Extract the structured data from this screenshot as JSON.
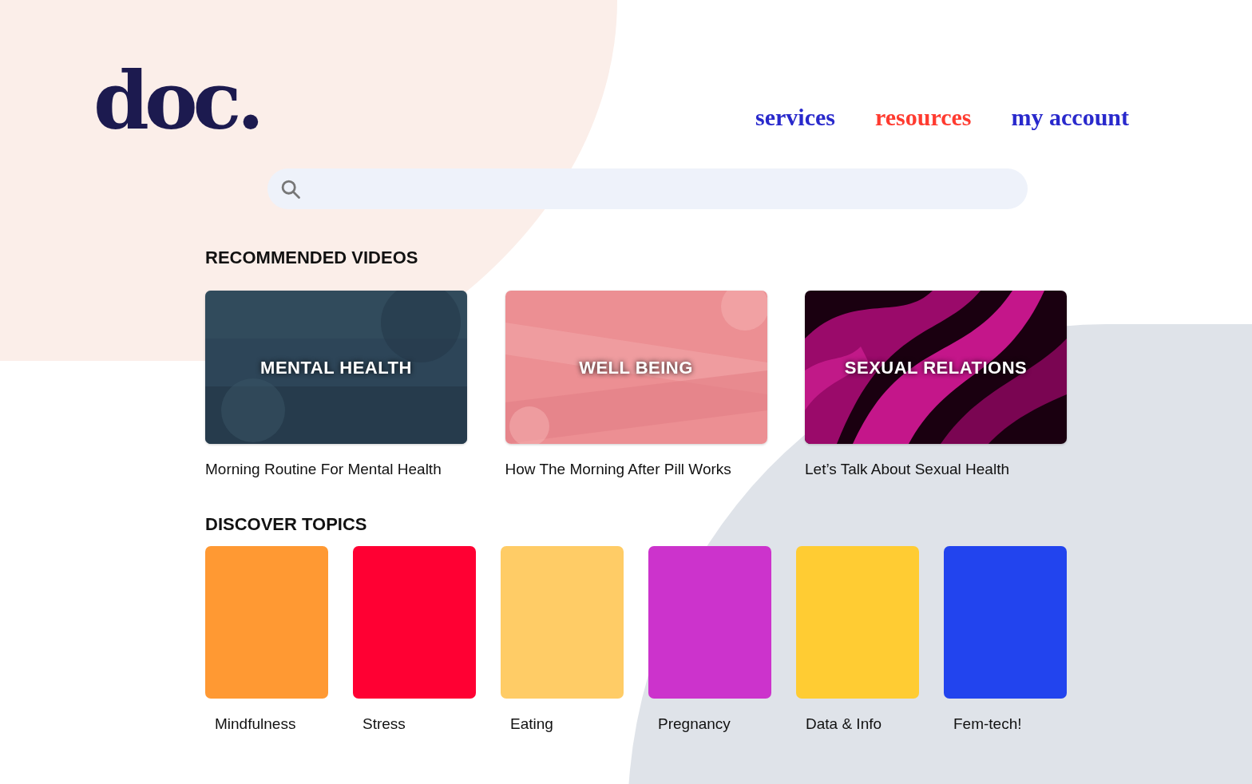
{
  "logo": "doc.",
  "nav": [
    {
      "label": "services",
      "selected": false
    },
    {
      "label": "resources",
      "selected": true
    },
    {
      "label": "my account",
      "selected": false
    }
  ],
  "recommended": {
    "heading": "RECOMMENDED VIDEOS",
    "videos": [
      {
        "overlay": "MENTAL HEALTH",
        "title": "Morning Routine For Mental Health",
        "kind": "denim"
      },
      {
        "overlay": "WELL BEING",
        "title": "How The Morning After Pill Works",
        "kind": "pink"
      },
      {
        "overlay": "SEXUAL RELATIONS",
        "title": "Let’s Talk About Sexual Health",
        "kind": "silk"
      }
    ]
  },
  "topics": {
    "heading": "DISCOVER TOPICS",
    "items": [
      {
        "label": "Mindfulness",
        "color": "#ff9933"
      },
      {
        "label": "Stress",
        "color": "#ff0033"
      },
      {
        "label": "Eating",
        "color": "#ffcc66"
      },
      {
        "label": "Pregnancy",
        "color": "#cc33cc"
      },
      {
        "label": "Data & Info",
        "color": "#ffcc33"
      },
      {
        "label": "Fem-tech!",
        "color": "#2244ee"
      }
    ]
  }
}
